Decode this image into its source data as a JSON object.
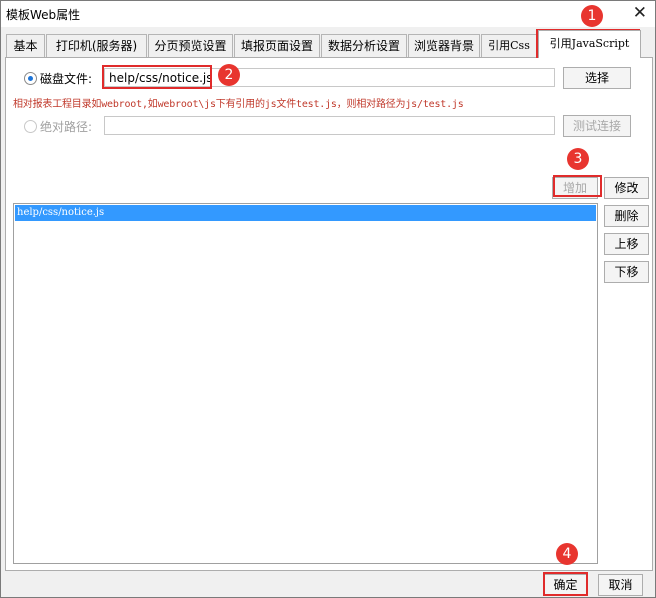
{
  "window": {
    "title": "模板Web属性",
    "close_glyph": "✕"
  },
  "tabs": [
    {
      "label": "基本"
    },
    {
      "label": "打印机(服务器)"
    },
    {
      "label": "分页预览设置"
    },
    {
      "label": "填报页面设置"
    },
    {
      "label": "数据分析设置"
    },
    {
      "label": "浏览器背景"
    },
    {
      "label": "引用Css"
    },
    {
      "label": "引用JavaScript"
    }
  ],
  "disk_file": {
    "label": "磁盘文件:",
    "value": "help/css/notice.js",
    "select_button": "选择"
  },
  "hint": "相对报表工程目录如webroot,如webroot\\js下有引用的js文件test.js，则相对路径为js/test.js",
  "absolute_path": {
    "label": "绝对路径:",
    "value": "",
    "test_button": "测试连接"
  },
  "actions": {
    "add": "增加",
    "modify": "修改",
    "delete": "删除",
    "up": "上移",
    "down": "下移"
  },
  "list": {
    "items": [
      "help/css/notice.js"
    ]
  },
  "footer": {
    "ok": "确定",
    "cancel": "取消"
  },
  "annotations": [
    "1",
    "2",
    "3",
    "4"
  ],
  "colors": {
    "annotation_red": "#e02b2b",
    "selection_blue": "#3399ff",
    "hint_red": "#c0392b"
  }
}
